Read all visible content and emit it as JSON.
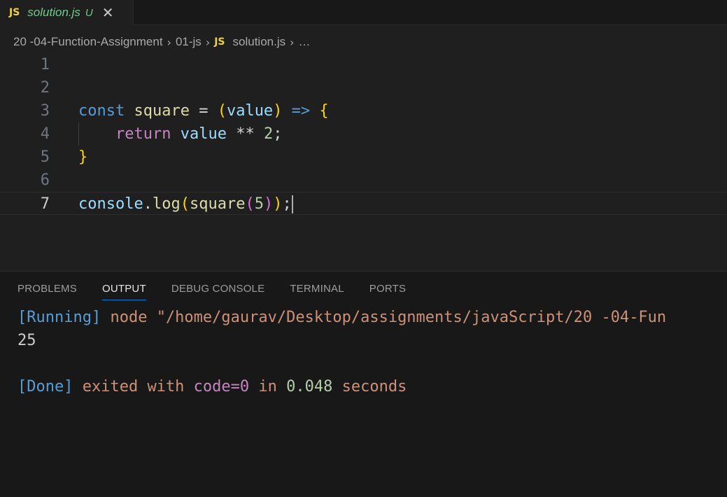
{
  "tab": {
    "badge": "JS",
    "name": "solution.js",
    "status": "U",
    "close": "✕"
  },
  "breadcrumb": {
    "parts": [
      "20 -04-Function-Assignment",
      "01-js",
      "solution.js",
      "…"
    ],
    "badge": "JS"
  },
  "editor": {
    "line_numbers": [
      "1",
      "2",
      "3",
      "4",
      "5",
      "6",
      "7"
    ],
    "active_line": "7",
    "lines": {
      "l3": {
        "kw": "const",
        "name": " square",
        "eq": " = ",
        "po": "(",
        "param": "value",
        "pc": ")",
        "arrow": " =>",
        "bo": " {"
      },
      "l4": {
        "indent": "    ",
        "kw": "return",
        "var": " value",
        "op": " ** ",
        "num": "2",
        "semi": ";"
      },
      "l5": {
        "bc": "}"
      },
      "l7": {
        "obj": "console",
        "dot": ".",
        "fn": "log",
        "p1o": "(",
        "fn2": "square",
        "p2o": "(",
        "num": "5",
        "p2c": ")",
        "p1c": ")",
        "semi": ";"
      }
    }
  },
  "panel": {
    "tabs": [
      "PROBLEMS",
      "OUTPUT",
      "DEBUG CONSOLE",
      "TERMINAL",
      "PORTS"
    ],
    "active_tab": "OUTPUT",
    "output": {
      "running_tag": "[Running]",
      "command": " node \"/home/gaurav/Desktop/assignments/javaScript/20 -04-Fun",
      "result": "25",
      "done_tag": "[Done]",
      "exited": " exited with ",
      "code": "code=0",
      "in": " in ",
      "time": "0.048",
      "seconds": " seconds"
    }
  },
  "colors": {
    "background": "#1f1f1f",
    "js_badge": "#f1d045",
    "untracked": "#73c991",
    "active_tab_underline": "#0078d4"
  }
}
